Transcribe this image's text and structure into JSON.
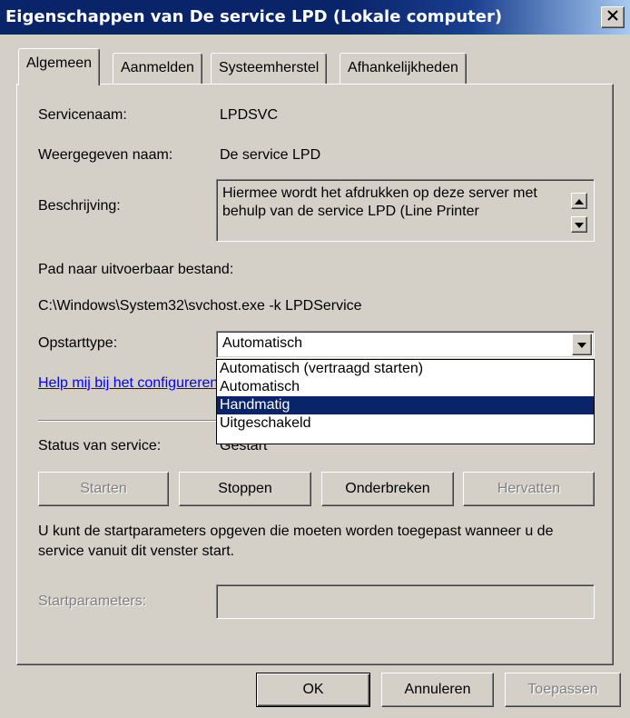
{
  "window": {
    "title": "Eigenschappen van De service LPD (Lokale computer)",
    "close_glyph": "✕"
  },
  "tabs": [
    {
      "label": "Algemeen",
      "active": true
    },
    {
      "label": "Aanmelden",
      "active": false
    },
    {
      "label": "Systeemherstel",
      "active": false
    },
    {
      "label": "Afhankelijkheden",
      "active": false
    }
  ],
  "general": {
    "service_name_label": "Servicenaam:",
    "service_name_value": "LPDSVC",
    "display_name_label": "Weergegeven naam:",
    "display_name_value": "De service LPD",
    "description_label": "Beschrijving:",
    "description_text": "Hiermee wordt het afdrukken op deze server met behulp van de service LPD (Line Printer",
    "path_label": "Pad naar uitvoerbaar bestand:",
    "path_value": "C:\\Windows\\System32\\svchost.exe -k LPDService",
    "startup_type_label": "Opstarttype:",
    "startup_type_value": "Automatisch",
    "startup_options": [
      "Automatisch (vertraagd starten)",
      "Automatisch",
      "Handmatig",
      "Uitgeschakeld"
    ],
    "startup_highlighted": "Handmatig",
    "help_link": "Help mij bij het configureren van opstartopties voor services.",
    "status_label": "Status van service:",
    "status_value": "Gestart"
  },
  "service_buttons": {
    "start": "Starten",
    "stop": "Stoppen",
    "pause": "Onderbreken",
    "resume": "Hervatten"
  },
  "start_params": {
    "info": "U kunt de startparameters opgeven die moeten worden toegepast wanneer u de service vanuit dit venster start.",
    "label": "Startparameters:",
    "value": ""
  },
  "footer": {
    "ok": "OK",
    "cancel": "Annuleren",
    "apply": "Toepassen"
  },
  "colors": {
    "face": "#d4d0c8",
    "title_bar": "#0a246a",
    "highlight": "#0a246a",
    "link": "#0000ff"
  },
  "icons": {
    "close": "close-icon",
    "scroll_up": "arrow-up-icon",
    "scroll_down": "arrow-down-icon",
    "dropdown": "chevron-down-icon"
  }
}
